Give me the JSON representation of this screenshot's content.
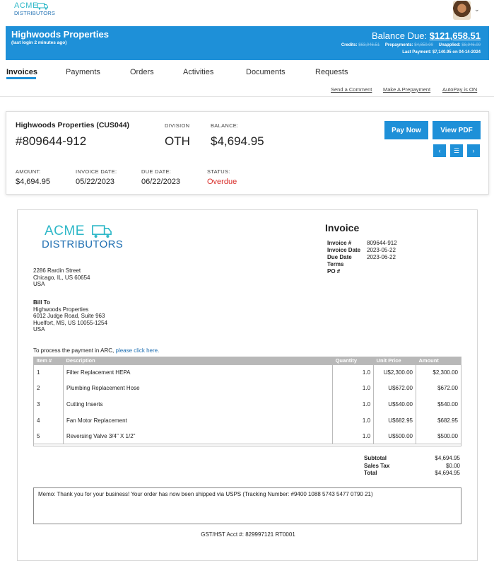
{
  "brand": {
    "name_line1": "ACME",
    "name_line2": "DISTRIBUTORS",
    "teal": "#2fb8c8",
    "blue": "#1f6fb2",
    "accent": "#1e90d8",
    "danger": "#d9302c"
  },
  "header": {
    "customer_name": "Highwoods Properties",
    "last_login": "(last login 2 minutes ago)",
    "balance_label": "Balance Due:",
    "balance_value": "$121,658.51",
    "credits_label": "Credits:",
    "credits_value": "$63,046.51",
    "prepayments_label": "Prepayments:",
    "prepayments_value": "$4,850.00",
    "unapplied_label": "Unapplied:",
    "unapplied_value": "$8,946.00",
    "last_payment": "Last Payment: $7,140.95 on 04-14-2024"
  },
  "tabs": [
    {
      "label": "Invoices",
      "active": true
    },
    {
      "label": "Payments"
    },
    {
      "label": "Orders"
    },
    {
      "label": "Activities"
    },
    {
      "label": "Documents"
    },
    {
      "label": "Requests"
    }
  ],
  "sublinks": {
    "send_comment": "Send a Comment",
    "prepayment": "Make A Prepayment",
    "autopay": "AutoPay is ON"
  },
  "invoice_card": {
    "customer": "Highwoods Properties (CUS044)",
    "invoice_number": "#809644-912",
    "division_label": "DIVISION",
    "division": "OTH",
    "balance_label": "BALANCE:",
    "balance": "$4,694.95",
    "amount_label": "AMOUNT:",
    "amount": "$4,694.95",
    "invoice_date_label": "INVOICE DATE:",
    "invoice_date": "05/22/2023",
    "due_date_label": "DUE DATE:",
    "due_date": "06/22/2023",
    "status_label": "STATUS:",
    "status": "Overdue",
    "pay_now": "Pay Now",
    "view_pdf": "View PDF",
    "prev": "‹",
    "list": "☰",
    "next": "›"
  },
  "document": {
    "from_address": [
      "2286 Rardin Street",
      "Chicago, IL, US 60654",
      "USA"
    ],
    "bill_to_label": "Bill To",
    "bill_to": [
      "Highwoods Properties",
      "6012 Judge Road, Suite 963",
      "Huelfort, MS, US 10055-1254",
      "USA"
    ],
    "payment_message": "To process the payment in ARC, ",
    "payment_link": "please click here.",
    "title": "Invoice",
    "meta": [
      {
        "k": "Invoice #",
        "v": "809644-912"
      },
      {
        "k": "Invoice Date",
        "v": "2023-05-22"
      },
      {
        "k": "Due Date",
        "v": "2023-06-22"
      },
      {
        "k": "Terms",
        "v": ""
      },
      {
        "k": "PO #",
        "v": ""
      }
    ],
    "columns": [
      "Item #",
      "Description",
      "Quantity",
      "Unit Price",
      "Amount"
    ],
    "items": [
      {
        "no": "1",
        "desc": "Filter Replacement HEPA",
        "qty": "1.0",
        "unit": "U$2,300.00",
        "amount": "$2,300.00"
      },
      {
        "no": "2",
        "desc": "Plumbing Replacement Hose",
        "qty": "1.0",
        "unit": "U$672.00",
        "amount": "$672.00"
      },
      {
        "no": "3",
        "desc": "Cutting Inserts",
        "qty": "1.0",
        "unit": "U$540.00",
        "amount": "$540.00"
      },
      {
        "no": "4",
        "desc": "Fan Motor Replacement",
        "qty": "1.0",
        "unit": "U$682.95",
        "amount": "$682.95"
      },
      {
        "no": "5",
        "desc": "Reversing Valve 3/4\" X 1/2\"",
        "qty": "1.0",
        "unit": "U$500.00",
        "amount": "$500.00"
      }
    ],
    "subtotal_label": "Subtotal",
    "subtotal": "$4,694.95",
    "tax_label": "Sales Tax",
    "tax": "$0.00",
    "total_label": "Total",
    "total": "$4,694.95",
    "memo": "Memo: Thank you for your business! Your order has now been shipped via USPS (Tracking Number: #9400 1088 5743 5477 0790 21)",
    "gst": "GST/HST Acct #: 829997121 RT0001"
  }
}
